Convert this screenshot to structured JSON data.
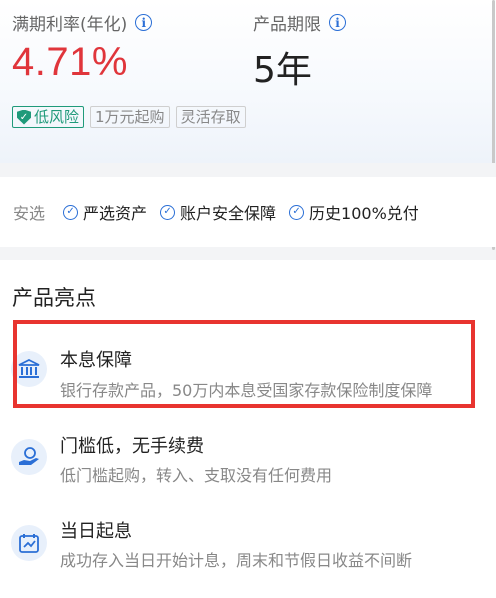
{
  "product": {
    "rate_label": "满期利率(年化)",
    "rate_value": "4.71%",
    "term_label": "产品期限",
    "term_value": "5年",
    "tags": {
      "risk": "低风险",
      "min": "1万元起购",
      "flex": "灵活存取"
    }
  },
  "select": {
    "label": "安选",
    "features": [
      "严选资产",
      "账户安全保障",
      "历史100%兑付"
    ]
  },
  "highlights": {
    "title": "产品亮点",
    "items": [
      {
        "title": "本息保障",
        "desc": "银行存款产品，50万内本息受国家存款保险制度保障",
        "icon": "bank-icon"
      },
      {
        "title": "门槛低，无手续费",
        "desc": "低门槛起购，转入、支取没有任何费用",
        "icon": "coin-hand-icon"
      },
      {
        "title": "当日起息",
        "desc": "成功存入当日开始计息，周末和节假日收益不间断",
        "icon": "calendar-icon"
      }
    ]
  },
  "colors": {
    "rate": "#e0353b",
    "accent": "#2b6fd6",
    "risk": "#1f9a7a",
    "highlight_box": "#e8342f"
  }
}
